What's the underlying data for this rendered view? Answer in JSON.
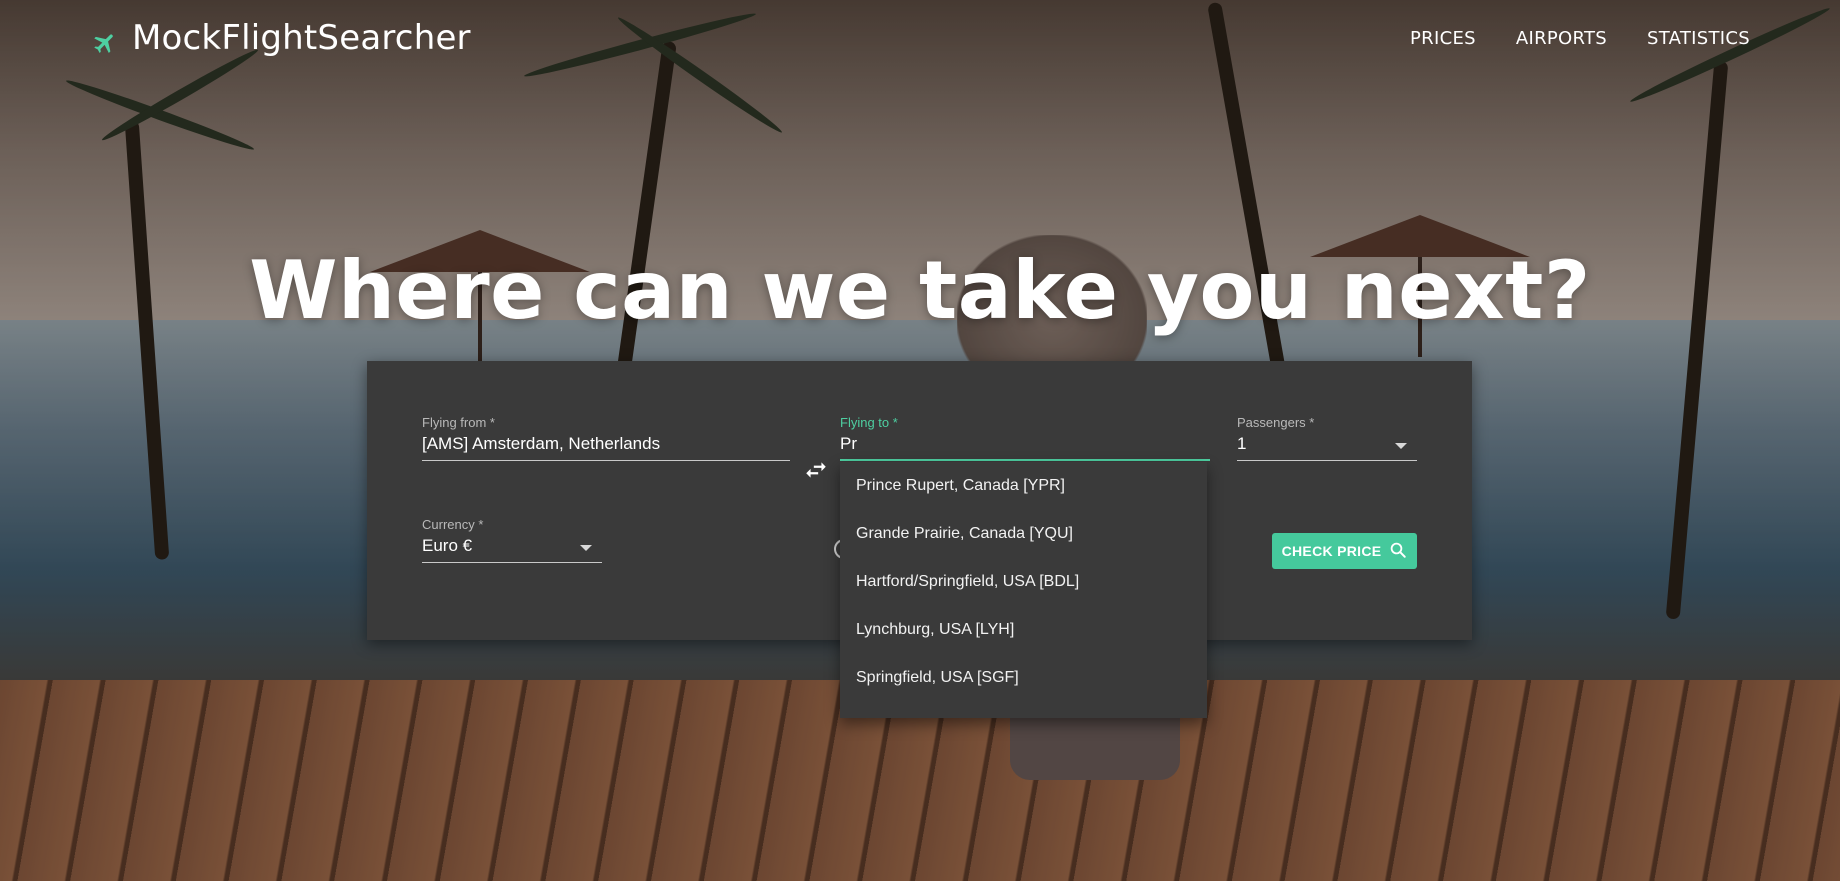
{
  "brand": {
    "name": "MockFlightSearcher",
    "icon": "airplane-icon",
    "accent": "#4ecfa1"
  },
  "nav": [
    {
      "label": "PRICES"
    },
    {
      "label": "AIRPORTS"
    },
    {
      "label": "STATISTICS"
    }
  ],
  "hero": {
    "title": "Where can we take you next?"
  },
  "form": {
    "flying_from": {
      "label": "Flying from *",
      "value": "[AMS] Amsterdam, Netherlands"
    },
    "flying_to": {
      "label": "Flying to *",
      "value": "Pr"
    },
    "passengers": {
      "label": "Passengers *",
      "value": "1"
    },
    "currency": {
      "label": "Currency *",
      "value": "Euro €"
    },
    "swap_icon": "swap-horizontal-icon",
    "check_price": {
      "label": "CHECK PRICE",
      "icon": "search-icon",
      "color": "#45c99c"
    }
  },
  "autocomplete": {
    "options": [
      {
        "label": "Prince Rupert, Canada [YPR]"
      },
      {
        "label": "Grande Prairie, Canada [YQU]"
      },
      {
        "label": "Hartford/Springfield, USA [BDL]"
      },
      {
        "label": "Lynchburg, USA [LYH]"
      },
      {
        "label": "Springfield, USA [SGF]"
      }
    ]
  }
}
